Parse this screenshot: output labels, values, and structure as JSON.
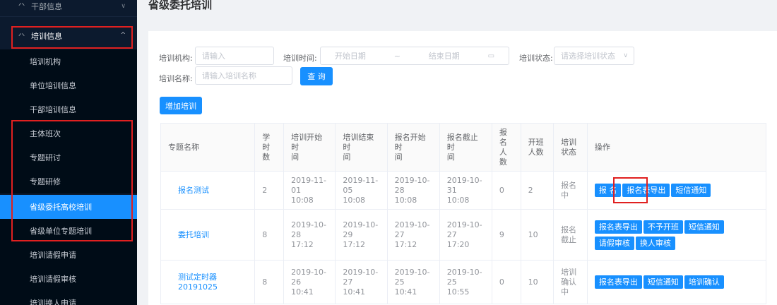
{
  "sidebar": {
    "top_item": "干部信息",
    "group": "培训信息",
    "items": [
      {
        "label": "培训机构"
      },
      {
        "label": "单位培训信息"
      },
      {
        "label": "干部培训信息"
      },
      {
        "label": "主体班次"
      },
      {
        "label": "专题研讨"
      },
      {
        "label": "专题研修"
      },
      {
        "label": "省级委托高校培训"
      },
      {
        "label": "省级单位专题培训"
      },
      {
        "label": "培训请假申请"
      },
      {
        "label": "培训请假审核"
      },
      {
        "label": "培训换人申请"
      }
    ],
    "active_index": 6
  },
  "page": {
    "title": "省级委托培训"
  },
  "filters": {
    "org_label": "培训机构:",
    "org_placeholder": "请输入",
    "time_label": "培训时间:",
    "start_placeholder": "开始日期",
    "range_sep": "~",
    "end_placeholder": "结束日期",
    "status_label": "培训状态:",
    "status_placeholder": "请选择培训状态",
    "name_label": "培训名称:",
    "name_placeholder": "请输入培训名称",
    "search_button": "查 询"
  },
  "toolbar": {
    "add_button": "增加培训"
  },
  "table": {
    "headers": [
      "专题名称",
      "学\n时\n数",
      "培训开始时\n间",
      "培训结束时\n间",
      "报名开始时\n间",
      "报名截止时\n间",
      "报名\n人数",
      "开班\n人数",
      "培训\n状态",
      "操作"
    ],
    "rows": [
      {
        "name": "报名测试",
        "hours": "2",
        "train_start": "2019-11-01\n10:08",
        "train_end": "2019-11-05\n10:08",
        "signup_start": "2019-10-28\n10:08",
        "signup_end": "2019-10-31\n10:08",
        "signup_count": "0",
        "class_count": "2",
        "status": "报名\n中",
        "actions": [
          "报 名",
          "报名表导出",
          "短信通知"
        ]
      },
      {
        "name": "委托培训",
        "hours": "8",
        "train_start": "2019-10-28\n17:12",
        "train_end": "2019-10-29\n17:12",
        "signup_start": "2019-10-27\n17:12",
        "signup_end": "2019-10-27\n17:20",
        "signup_count": "9",
        "class_count": "10",
        "status": "报名\n截止",
        "actions": [
          "报名表导出",
          "不予开班",
          "短信通知",
          "请假审核",
          "换人审核"
        ]
      },
      {
        "name": "测试定时器20191025",
        "hours": "8",
        "train_start": "2019-10-26\n10:41",
        "train_end": "2019-10-27\n10:41",
        "signup_start": "2019-10-25\n10:41",
        "signup_end": "2019-10-25\n10:55",
        "signup_count": "0",
        "class_count": "10",
        "status": "培训\n确认\n中",
        "actions": [
          "报名表导出",
          "短信通知",
          "培训确认"
        ]
      }
    ]
  },
  "colors": {
    "sidebar_bg": "#0c1a2e",
    "accent": "#1890ff",
    "highlight_box": "#e02020"
  }
}
